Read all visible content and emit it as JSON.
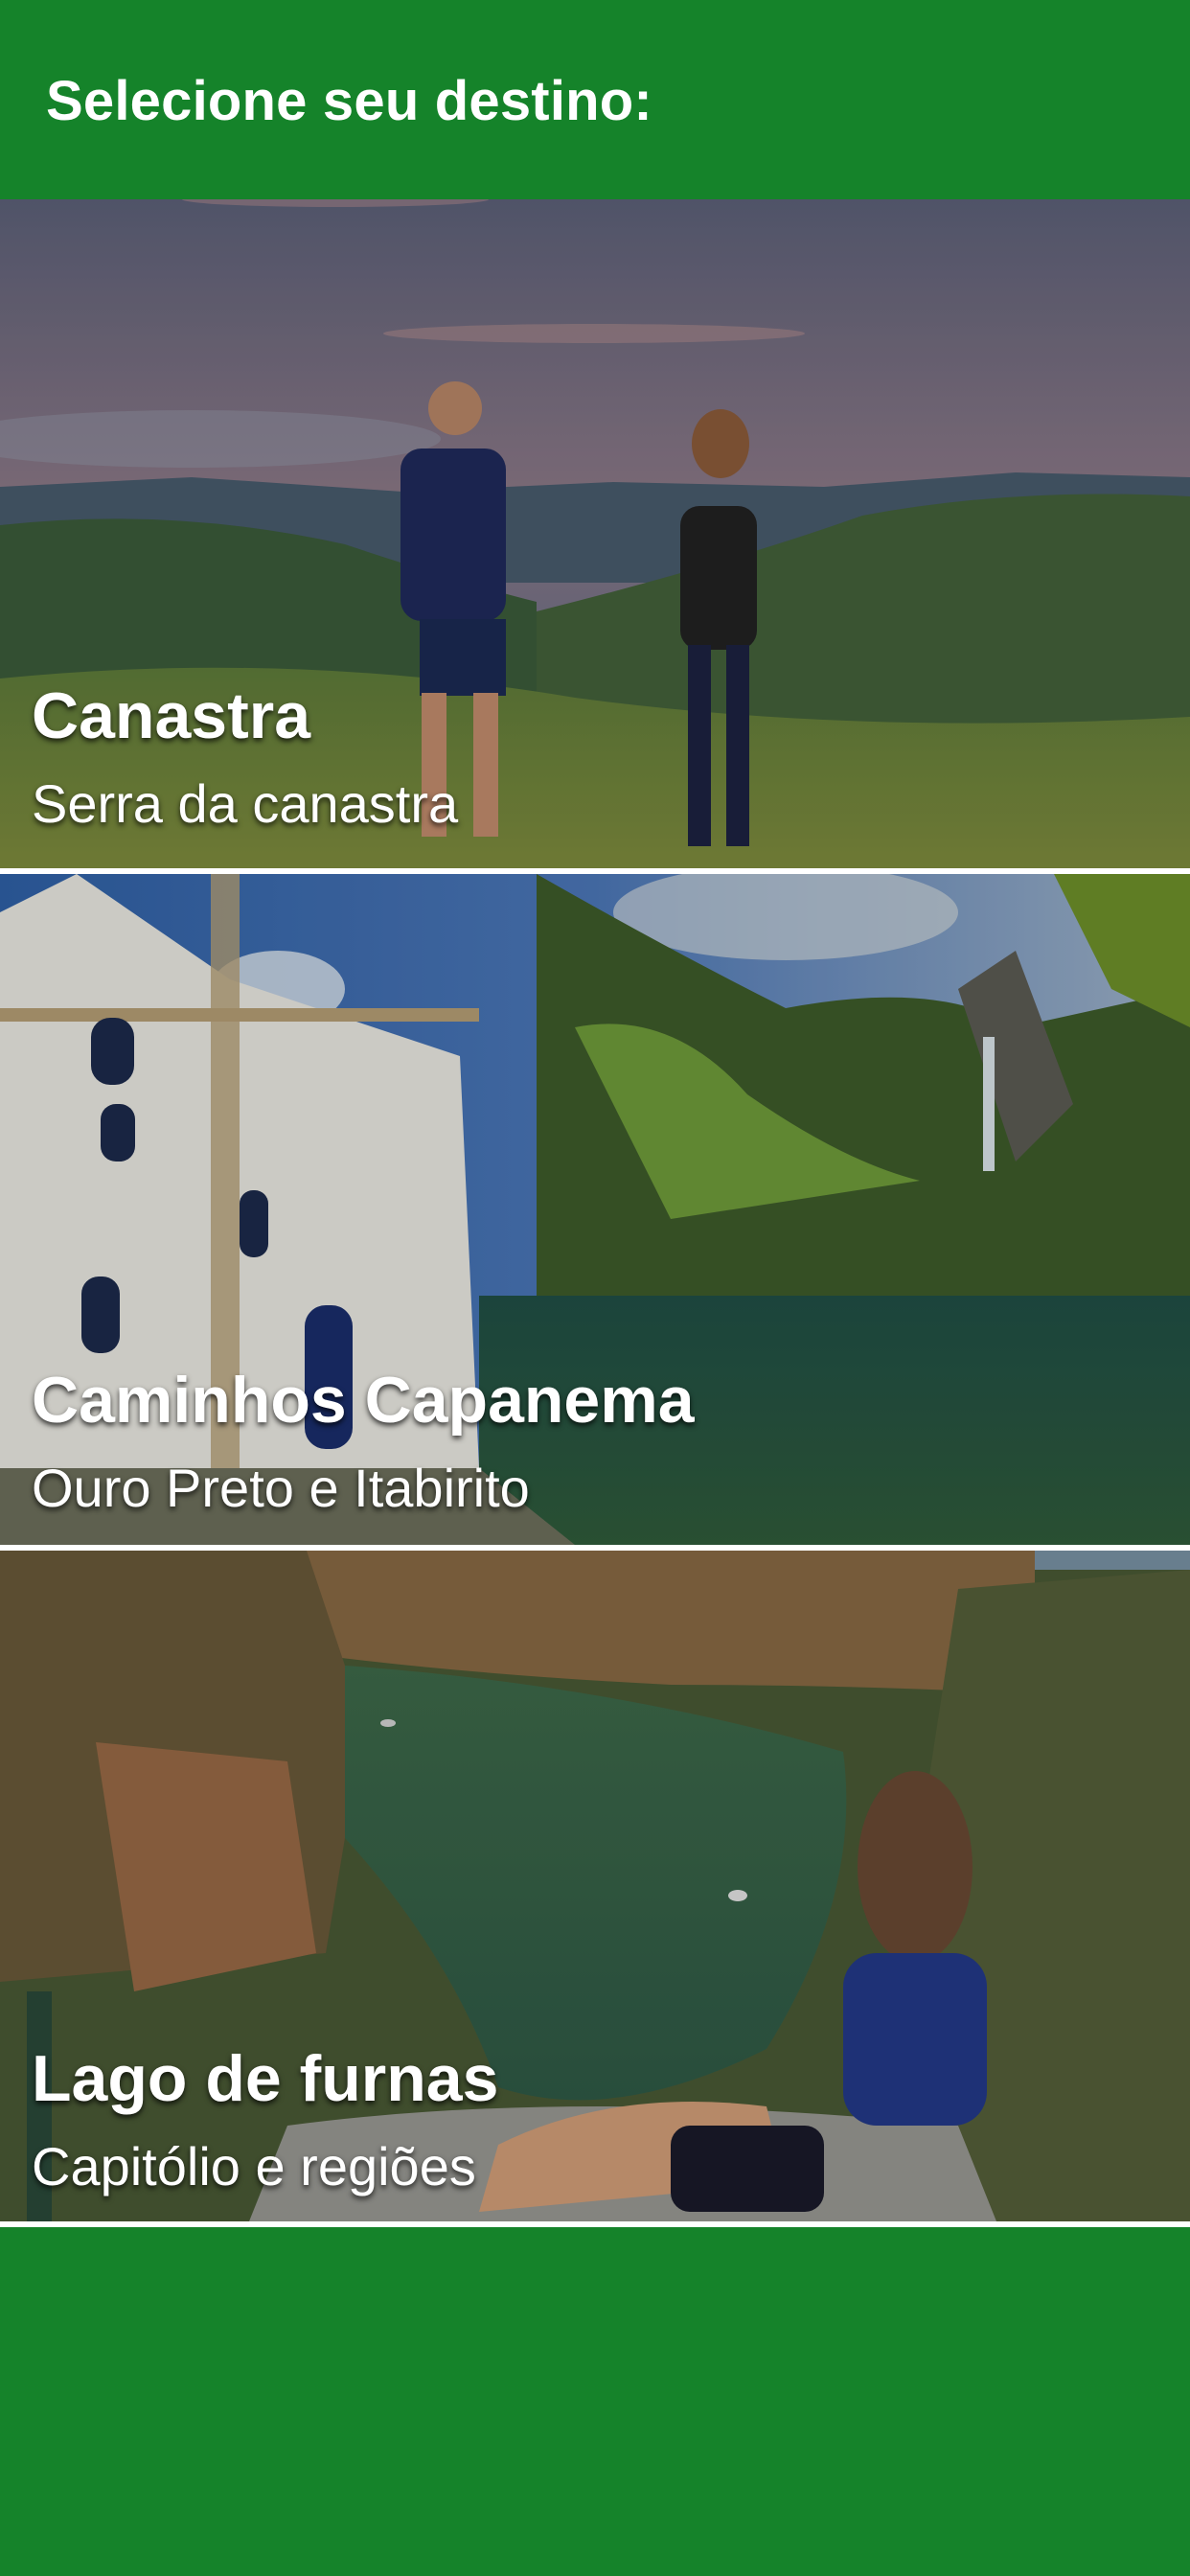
{
  "header": {
    "title": "Selecione seu destino:"
  },
  "destinations": [
    {
      "title": "Canastra",
      "subtitle": "Serra da canastra",
      "image": "mountain-couple-photo"
    },
    {
      "title": "Caminhos Capanema",
      "subtitle": "Ouro Preto e Itabirito",
      "image": "church-waterfall-photo"
    },
    {
      "title": "Lago de furnas",
      "subtitle": "Capitólio e regiões",
      "image": "canyon-lake-photo"
    }
  ],
  "colors": {
    "brand_green": "#15832a",
    "text": "#ffffff"
  }
}
